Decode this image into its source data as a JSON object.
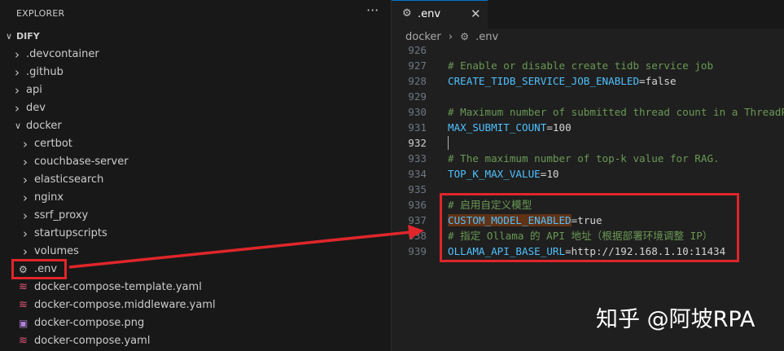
{
  "explorer": {
    "title": "EXPLORER",
    "more": "···",
    "root": "DIFY",
    "items": [
      {
        "label": ".devcontainer",
        "type": "folder"
      },
      {
        "label": ".github",
        "type": "folder"
      },
      {
        "label": "api",
        "type": "folder"
      },
      {
        "label": "dev",
        "type": "folder"
      },
      {
        "label": "docker",
        "type": "folder-open"
      },
      {
        "label": "certbot",
        "type": "folder"
      },
      {
        "label": "couchbase-server",
        "type": "folder"
      },
      {
        "label": "elasticsearch",
        "type": "folder"
      },
      {
        "label": "nginx",
        "type": "folder"
      },
      {
        "label": "ssrf_proxy",
        "type": "folder"
      },
      {
        "label": "startupscripts",
        "type": "folder"
      },
      {
        "label": "volumes",
        "type": "folder"
      },
      {
        "label": ".env",
        "type": "gear-file"
      },
      {
        "label": "docker-compose-template.yaml",
        "type": "docker-file"
      },
      {
        "label": "docker-compose.middleware.yaml",
        "type": "docker-file"
      },
      {
        "label": "docker-compose.png",
        "type": "image-file"
      },
      {
        "label": "docker-compose.yaml",
        "type": "docker-file"
      }
    ]
  },
  "editor": {
    "tab_label": ".env",
    "tab_close": "✕",
    "breadcrumb": [
      "docker",
      ".env"
    ],
    "lines": [
      {
        "num": "926",
        "kind": "empty",
        "text": ""
      },
      {
        "num": "927",
        "kind": "comment",
        "text": "# Enable or disable create tidb service job"
      },
      {
        "num": "928",
        "kind": "kv",
        "key": "CREATE_TIDB_SERVICE_JOB_ENABLED",
        "value": "=false"
      },
      {
        "num": "929",
        "kind": "empty",
        "text": ""
      },
      {
        "num": "930",
        "kind": "comment",
        "text": "# Maximum number of submitted thread count in a ThreadPool"
      },
      {
        "num": "931",
        "kind": "kv",
        "key": "MAX_SUBMIT_COUNT",
        "value": "=100"
      },
      {
        "num": "932",
        "kind": "empty",
        "text": ""
      },
      {
        "num": "933",
        "kind": "comment",
        "text": "# The maximum number of top-k value for RAG."
      },
      {
        "num": "934",
        "kind": "kv",
        "key": "TOP_K_MAX_VALUE",
        "value": "=10"
      },
      {
        "num": "935",
        "kind": "empty",
        "text": ""
      },
      {
        "num": "936",
        "kind": "comment",
        "text": "# 启用自定义模型"
      },
      {
        "num": "937",
        "kind": "kv",
        "key": "CUSTOM_MODEL_ENABLED",
        "value": "=true"
      },
      {
        "num": "938",
        "kind": "comment",
        "text": "# 指定 Ollama 的 API 地址（根据部署环境调整 IP）"
      },
      {
        "num": "939",
        "kind": "kv",
        "key": "OLLAMA_API_BASE_URL",
        "value": "=http://192.168.1.10:11434"
      }
    ],
    "active_line": "932"
  },
  "watermark": "知乎 @阿坡RPA",
  "colors": {
    "annotation": "#e0262a",
    "comment": "#6a9955",
    "key": "#4fc1ff",
    "docker_icon": "#e8557a"
  }
}
